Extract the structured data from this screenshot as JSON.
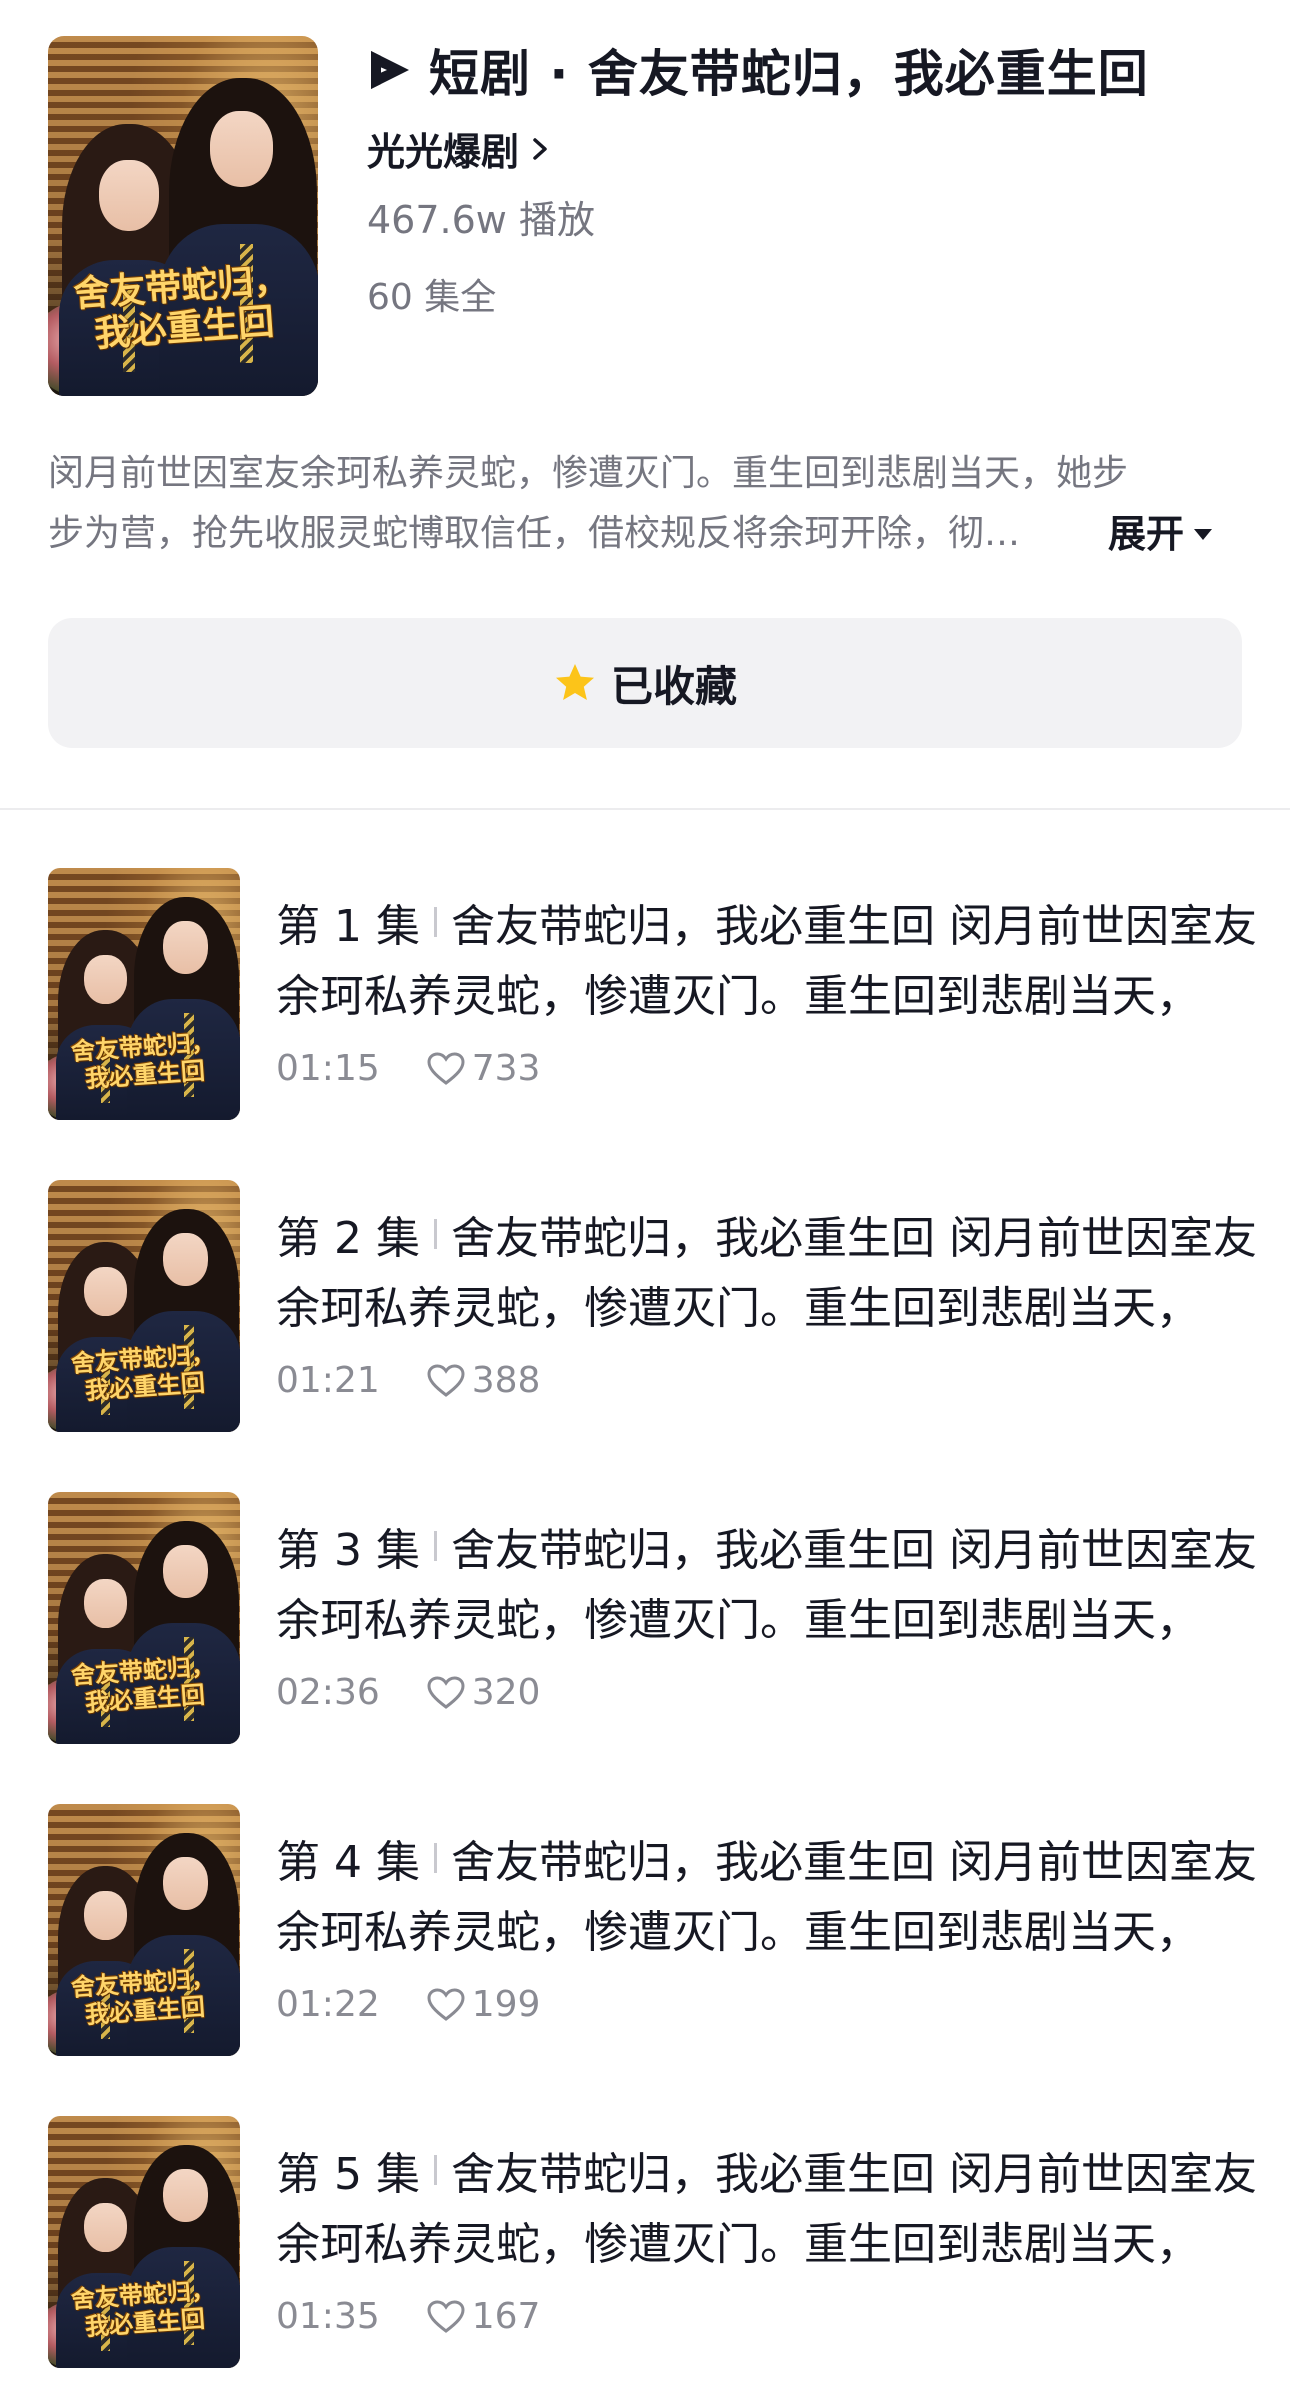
{
  "header": {
    "logo_icon": "play-logo-icon",
    "title": "短剧 · 舍友带蛇归，我必重生回",
    "author": "光光爆剧",
    "plays": "467.6w 播放",
    "episodes_total": "60 集全",
    "poster_title_line1": "舍友带蛇归，",
    "poster_title_line2": "我必重生回"
  },
  "description": {
    "line1": "闵月前世因室友余珂私养灵蛇，惨遭灭门。重生回到悲剧当天，她步",
    "line2": "步为营，抢先收服灵蛇博取信任，借校规反将余珂开除，彻…",
    "expand_label": "展开"
  },
  "favorite": {
    "label": "已收藏",
    "icon": "star-icon",
    "star_color": "#fcc419"
  },
  "episodes": [
    {
      "label": "第 1 集",
      "title": "舍友带蛇归，我必重生回 闵月前世因室友",
      "desc": "余珂私养灵蛇，惨遭灭门。重生回到悲剧当天，",
      "duration": "01:15",
      "likes": "733"
    },
    {
      "label": "第 2 集",
      "title": "舍友带蛇归，我必重生回 闵月前世因室友",
      "desc": "余珂私养灵蛇，惨遭灭门。重生回到悲剧当天，",
      "duration": "01:21",
      "likes": "388"
    },
    {
      "label": "第 3 集",
      "title": "舍友带蛇归，我必重生回 闵月前世因室友",
      "desc": "余珂私养灵蛇，惨遭灭门。重生回到悲剧当天，",
      "duration": "02:36",
      "likes": "320"
    },
    {
      "label": "第 4 集",
      "title": "舍友带蛇归，我必重生回 闵月前世因室友",
      "desc": "余珂私养灵蛇，惨遭灭门。重生回到悲剧当天，",
      "duration": "01:22",
      "likes": "199"
    },
    {
      "label": "第 5 集",
      "title": "舍友带蛇归，我必重生回 闵月前世因室友",
      "desc": "余珂私养灵蛇，惨遭灭门。重生回到悲剧当天，",
      "duration": "01:35",
      "likes": "167"
    }
  ]
}
